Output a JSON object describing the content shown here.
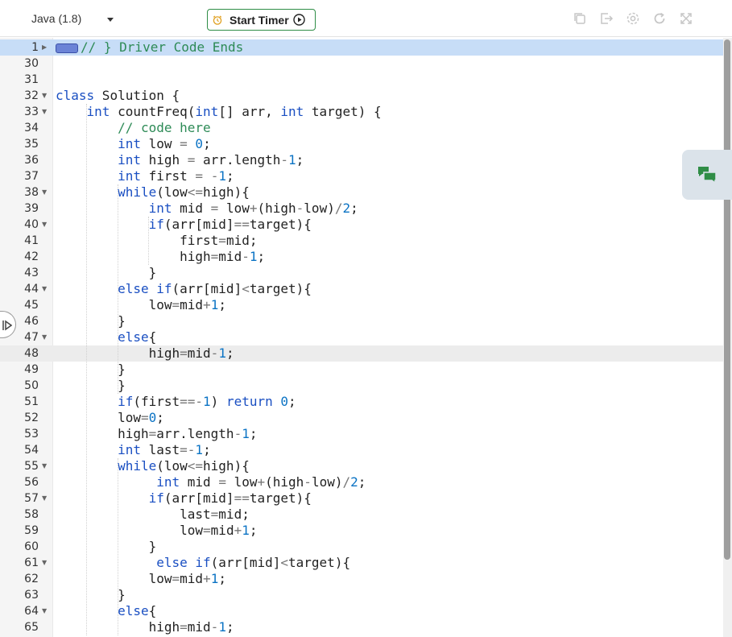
{
  "toolbar": {
    "language": "Java (1.8)",
    "start_timer_label": "Start Timer"
  },
  "editor": {
    "lines": [
      {
        "n": "1",
        "fold": "collapsed",
        "code": "// } Driver Code Ends",
        "hl": "blue"
      },
      {
        "n": "30",
        "code": ""
      },
      {
        "n": "31",
        "code": ""
      },
      {
        "n": "32",
        "fold": "open",
        "code": "class Solution {"
      },
      {
        "n": "33",
        "fold": "open",
        "code": "    int countFreq(int[] arr, int target) {"
      },
      {
        "n": "34",
        "code": "        // code here"
      },
      {
        "n": "35",
        "code": "        int low = 0;"
      },
      {
        "n": "36",
        "code": "        int high = arr.length-1;"
      },
      {
        "n": "37",
        "code": "        int first = -1;"
      },
      {
        "n": "38",
        "fold": "open",
        "code": "        while(low<=high){"
      },
      {
        "n": "39",
        "code": "            int mid = low+(high-low)/2;"
      },
      {
        "n": "40",
        "fold": "open",
        "code": "            if(arr[mid]==target){"
      },
      {
        "n": "41",
        "code": "                first=mid;"
      },
      {
        "n": "42",
        "code": "                high=mid-1;"
      },
      {
        "n": "43",
        "code": "            }"
      },
      {
        "n": "44",
        "fold": "open",
        "code": "        else if(arr[mid]<target){"
      },
      {
        "n": "45",
        "code": "            low=mid+1;"
      },
      {
        "n": "46",
        "code": "        }"
      },
      {
        "n": "47",
        "fold": "open",
        "code": "        else{"
      },
      {
        "n": "48",
        "code": "            high=mid-1;",
        "hl": "grey"
      },
      {
        "n": "49",
        "code": "        }"
      },
      {
        "n": "50",
        "code": "        }"
      },
      {
        "n": "51",
        "code": "        if(first==-1) return 0;"
      },
      {
        "n": "52",
        "code": "        low=0;"
      },
      {
        "n": "53",
        "code": "        high=arr.length-1;"
      },
      {
        "n": "54",
        "code": "        int last=-1;"
      },
      {
        "n": "55",
        "fold": "open",
        "code": "        while(low<=high){"
      },
      {
        "n": "56",
        "code": "             int mid = low+(high-low)/2;"
      },
      {
        "n": "57",
        "fold": "open",
        "code": "            if(arr[mid]==target){"
      },
      {
        "n": "58",
        "code": "                last=mid;"
      },
      {
        "n": "59",
        "code": "                low=mid+1;"
      },
      {
        "n": "60",
        "code": "            }"
      },
      {
        "n": "61",
        "fold": "open",
        "code": "             else if(arr[mid]<target){"
      },
      {
        "n": "62",
        "code": "            low=mid+1;"
      },
      {
        "n": "63",
        "code": "        }"
      },
      {
        "n": "64",
        "fold": "open",
        "code": "        else{"
      },
      {
        "n": "65",
        "code": "            high=mid-1;"
      }
    ]
  },
  "icons": {
    "toolbar": [
      "copy-icon",
      "export-icon",
      "settings-icon",
      "reset-icon",
      "fullscreen-icon"
    ],
    "chat": "chat-icon",
    "side": "expand-panel-icon"
  },
  "colors": {
    "accent_green": "#2f8d46",
    "keyword": "#1a4fc2",
    "comment": "#2e8b57",
    "number": "#0b73c4",
    "line_highlight_blue": "#c7ddf7",
    "active_line": "#ececec"
  }
}
